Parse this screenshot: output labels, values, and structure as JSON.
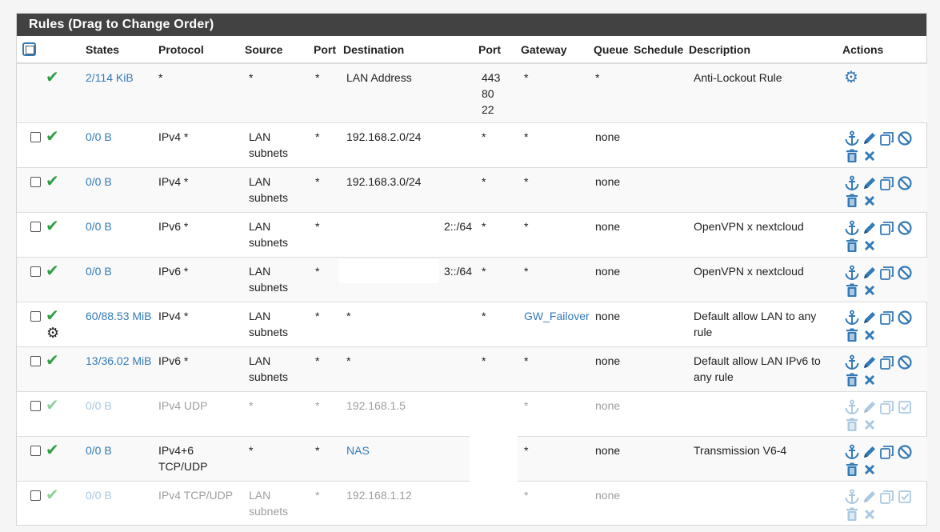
{
  "panel": {
    "title": "Rules (Drag to Change Order)"
  },
  "columns": [
    "States",
    "Protocol",
    "Source",
    "Port",
    "Destination",
    "Port",
    "Gateway",
    "Queue",
    "Schedule",
    "Description",
    "Actions"
  ],
  "rows": [
    {
      "states": "2/114 KiB",
      "protocol": "*",
      "source": "*",
      "sport": "*",
      "destination": "LAN Address",
      "dport": "443\n80\n22",
      "gateway": "*",
      "queue": "*",
      "schedule": "",
      "description": "Anti-Lockout Rule"
    },
    {
      "states": "0/0 B",
      "protocol": "IPv4 *",
      "source": "LAN subnets",
      "sport": "*",
      "destination": "192.168.2.0/24",
      "dport": "*",
      "gateway": "*",
      "queue": "none",
      "schedule": "",
      "description": ""
    },
    {
      "states": "0/0 B",
      "protocol": "IPv4 *",
      "source": "LAN subnets",
      "sport": "*",
      "destination": "192.168.3.0/24",
      "dport": "*",
      "gateway": "*",
      "queue": "none",
      "schedule": "",
      "description": ""
    },
    {
      "states": "0/0 B",
      "protocol": "IPv6 *",
      "source": "LAN subnets",
      "sport": "*",
      "destination": "2::/64",
      "dport": "*",
      "gateway": "*",
      "queue": "none",
      "schedule": "",
      "description": "OpenVPN x nextcloud"
    },
    {
      "states": "0/0 B",
      "protocol": "IPv6 *",
      "source": "LAN subnets",
      "sport": "*",
      "destination": "3::/64",
      "dport": "*",
      "gateway": "*",
      "queue": "none",
      "schedule": "",
      "description": "OpenVPN x nextcloud"
    },
    {
      "states": "60/88.53 MiB",
      "protocol": "IPv4 *",
      "source": "LAN subnets",
      "sport": "*",
      "destination": "*",
      "dport": "*",
      "gateway": "GW_Failover",
      "queue": "none",
      "schedule": "",
      "description": "Default allow LAN to any rule"
    },
    {
      "states": "13/36.02 MiB",
      "protocol": "IPv6 *",
      "source": "LAN subnets",
      "sport": "*",
      "destination": "*",
      "dport": "*",
      "gateway": "*",
      "queue": "none",
      "schedule": "",
      "description": "Default allow LAN IPv6 to any rule"
    },
    {
      "states": "0/0 B",
      "protocol": "IPv4 UDP",
      "source": "*",
      "sport": "*",
      "destination": "192.168.1.5",
      "dport": "",
      "gateway": "*",
      "queue": "none",
      "schedule": "",
      "description": ""
    },
    {
      "states": "0/0 B",
      "protocol": "IPv4+6 TCP/UDP",
      "source": "*",
      "sport": "*",
      "destination": "NAS",
      "dport": "",
      "gateway": "*",
      "queue": "none",
      "schedule": "",
      "description": "Transmission V6-4"
    },
    {
      "states": "0/0 B",
      "protocol": "IPv4 TCP/UDP",
      "source": "LAN subnets",
      "sport": "*",
      "destination": "192.168.1.12",
      "dport": "",
      "gateway": "*",
      "queue": "none",
      "schedule": "",
      "description": ""
    }
  ]
}
